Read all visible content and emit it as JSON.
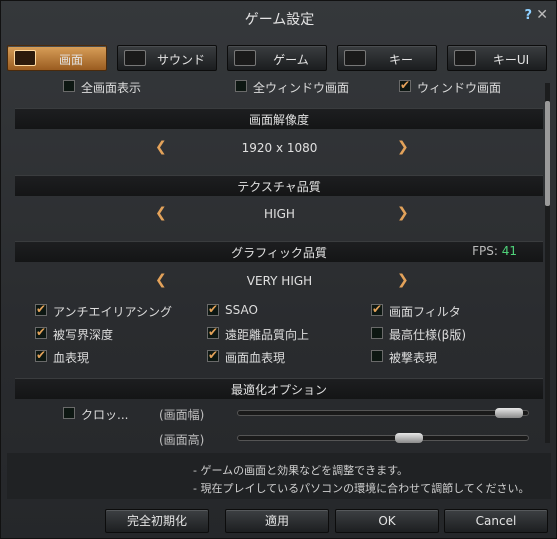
{
  "window": {
    "title": "ゲーム設定",
    "help": "?",
    "close": "✕"
  },
  "tabs": [
    {
      "label": "画面",
      "icon": "monitor-icon",
      "active": true
    },
    {
      "label": "サウンド",
      "icon": "speaker-icon",
      "active": false
    },
    {
      "label": "ゲーム",
      "icon": "gamepad-icon",
      "active": false
    },
    {
      "label": "キー",
      "icon": "keyboard-icon",
      "active": false
    },
    {
      "label": "キーUI",
      "icon": "windows-icon",
      "active": false
    }
  ],
  "display_mode": [
    {
      "label": "全画面表示",
      "checked": false
    },
    {
      "label": "全ウィンドウ画面",
      "checked": false
    },
    {
      "label": "ウィンドウ画面",
      "checked": true
    }
  ],
  "resolution": {
    "heading": "画面解像度",
    "value": "1920 x 1080"
  },
  "texture": {
    "heading": "テクスチャ品質",
    "value": "HIGH"
  },
  "graphics": {
    "heading": "グラフィック品質",
    "fps_label": "FPS:",
    "fps_value": "41",
    "value": "VERY HIGH"
  },
  "options": [
    {
      "label": "アンチエイリアシング",
      "checked": true
    },
    {
      "label": "SSAO",
      "checked": true
    },
    {
      "label": "画面フィルタ",
      "checked": true
    },
    {
      "label": "被写界深度",
      "checked": true
    },
    {
      "label": "遠距離品質向上",
      "checked": true
    },
    {
      "label": "最高仕様(β版)",
      "checked": false
    },
    {
      "label": "血表現",
      "checked": true
    },
    {
      "label": "画面血表現",
      "checked": true
    },
    {
      "label": "被撃表現",
      "checked": false
    }
  ],
  "optimization": {
    "heading": "最適化オプション",
    "crop_label": "クロッ...",
    "crop_checked": false,
    "width_label": "(画面幅)",
    "height_label": "(画面高)",
    "width_level": 0.98,
    "height_level": 0.6
  },
  "info": [
    "- ゲームの画面と効果などを調整できます。",
    "- 現在プレイしているパソコンの環境に合わせて調節してください。"
  ],
  "buttons": {
    "reset": "完全初期化",
    "apply": "適用",
    "ok": "OK",
    "cancel": "Cancel"
  },
  "arrows": {
    "left": "❮",
    "right": "❯"
  }
}
